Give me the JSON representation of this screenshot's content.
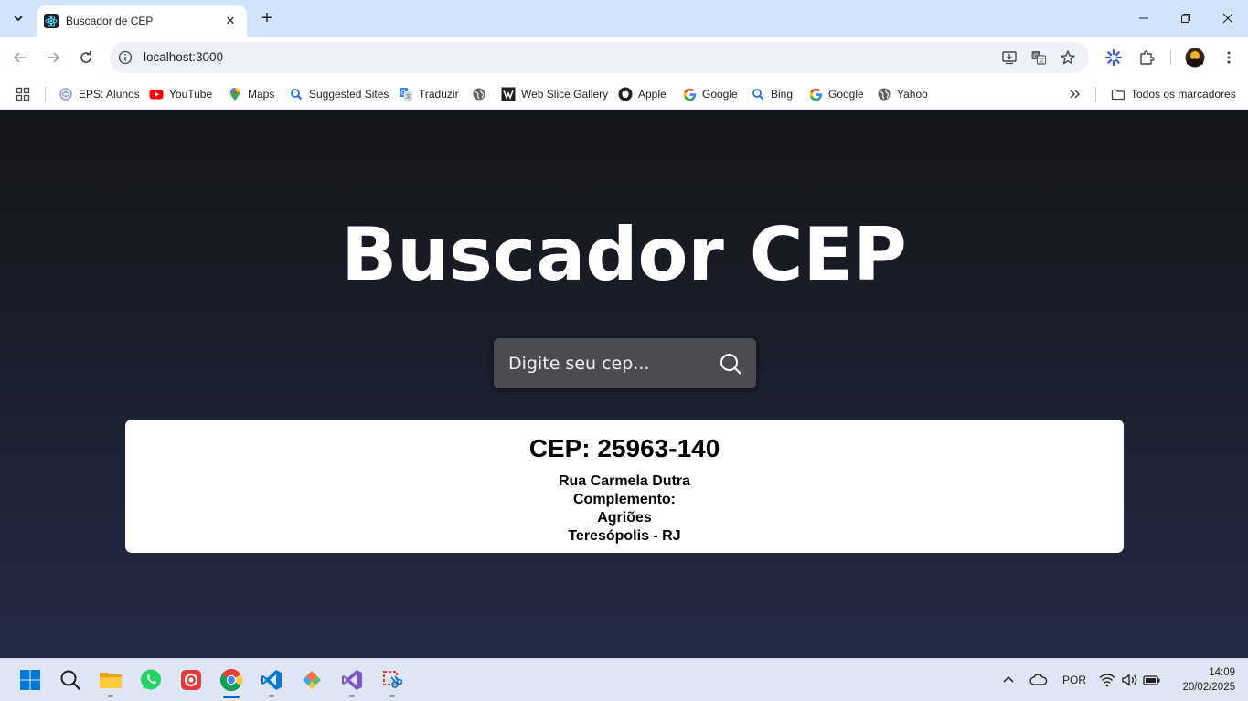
{
  "browser": {
    "tab_title": "Buscador de CEP",
    "url": "localhost:3000"
  },
  "bookmarks": [
    {
      "label": "EPS: Alunos",
      "icon": "eps-icon"
    },
    {
      "label": "YouTube",
      "icon": "youtube-icon"
    },
    {
      "label": "Maps",
      "icon": "maps-icon"
    },
    {
      "label": "Suggested Sites",
      "icon": "search-icon"
    },
    {
      "label": "Traduzir",
      "icon": "translate-icon"
    },
    {
      "label": "",
      "icon": "globe-icon"
    },
    {
      "label": "Web Slice Gallery",
      "icon": "web-slice-icon"
    },
    {
      "label": "Apple",
      "icon": "apple-icon"
    },
    {
      "label": "Google",
      "icon": "google-icon"
    },
    {
      "label": "Bing",
      "icon": "search-icon"
    },
    {
      "label": "Google",
      "icon": "google-icon"
    },
    {
      "label": "Yahoo",
      "icon": "globe-icon"
    }
  ],
  "all_bookmarks_label": "Todos os marcadores",
  "app": {
    "title": "Buscador CEP",
    "search_placeholder": "Digite seu cep...",
    "result": {
      "cep": "CEP: 25963-140",
      "street": "Rua Carmela Dutra",
      "complement": "Complemento:",
      "neighborhood": "Agriões",
      "city_state": "Teresópolis - RJ"
    }
  },
  "taskbar": {
    "language": "POR",
    "time": "14:09",
    "date": "20/02/2025"
  },
  "colors": {
    "page_bg_top": "#141518",
    "page_bg_bottom": "#232a45",
    "search_bg": "#4b4c52",
    "tab_strip": "#d3e3fd"
  }
}
